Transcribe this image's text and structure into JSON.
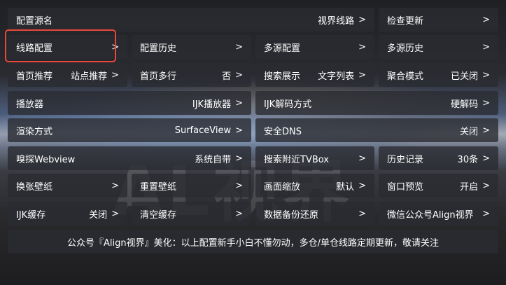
{
  "watermark": "AL视界",
  "rows": [
    [
      {
        "label": "配置源名",
        "value": "视界线路",
        "arrow": ">"
      },
      {
        "label": "检查更新",
        "value": "",
        "arrow": ">"
      }
    ],
    [
      {
        "label": "线路配置",
        "value": "",
        "arrow": ">"
      },
      {
        "label": "配置历史",
        "value": "",
        "arrow": ">"
      },
      {
        "label": "多源配置",
        "value": "",
        "arrow": ">"
      },
      {
        "label": "多源历史",
        "value": "",
        "arrow": ">"
      }
    ],
    [
      {
        "label": "首页推荐",
        "value": "站点推荐",
        "arrow": ">"
      },
      {
        "label": "首页多行",
        "value": "否",
        "arrow": ">"
      },
      {
        "label": "搜索展示",
        "value": "文字列表",
        "arrow": ">"
      },
      {
        "label": "聚合模式",
        "value": "已关闭",
        "arrow": ">"
      }
    ],
    [
      {
        "label": "播放器",
        "value": "IJK播放器",
        "arrow": ">"
      },
      {
        "label": "IJK解码方式",
        "value": "硬解码",
        "arrow": ">"
      }
    ],
    [
      {
        "label": "渲染方式",
        "value": "SurfaceView",
        "arrow": ">"
      },
      {
        "label": "安全DNS",
        "value": "关闭",
        "arrow": ">"
      }
    ],
    [
      {
        "label": "嗅探Webview",
        "value": "系统自带",
        "arrow": ">"
      },
      {
        "label": "搜索附近TVBox",
        "value": "",
        "arrow": ">"
      },
      {
        "label": "历史记录",
        "value": "30条",
        "arrow": ">"
      }
    ],
    [
      {
        "label": "换张壁纸",
        "value": "",
        "arrow": ">"
      },
      {
        "label": "重置壁纸",
        "value": "",
        "arrow": ">"
      },
      {
        "label": "画面缩放",
        "value": "默认",
        "arrow": ">"
      },
      {
        "label": "窗口预览",
        "value": "开启",
        "arrow": ">"
      }
    ],
    [
      {
        "label": "IJK缓存",
        "value": "关闭",
        "arrow": ">"
      },
      {
        "label": "清空缓存",
        "value": "",
        "arrow": ">"
      },
      {
        "label": "数据备份还原",
        "value": "",
        "arrow": ">"
      },
      {
        "label": "微信公众号Align视界",
        "value": "",
        "arrow": ">"
      }
    ]
  ],
  "footer": "公众号『Align视界』美化：以上配置新手小白不懂勿动，多仓/单仓线路定期更新，敬请关注",
  "selected": "线路配置"
}
